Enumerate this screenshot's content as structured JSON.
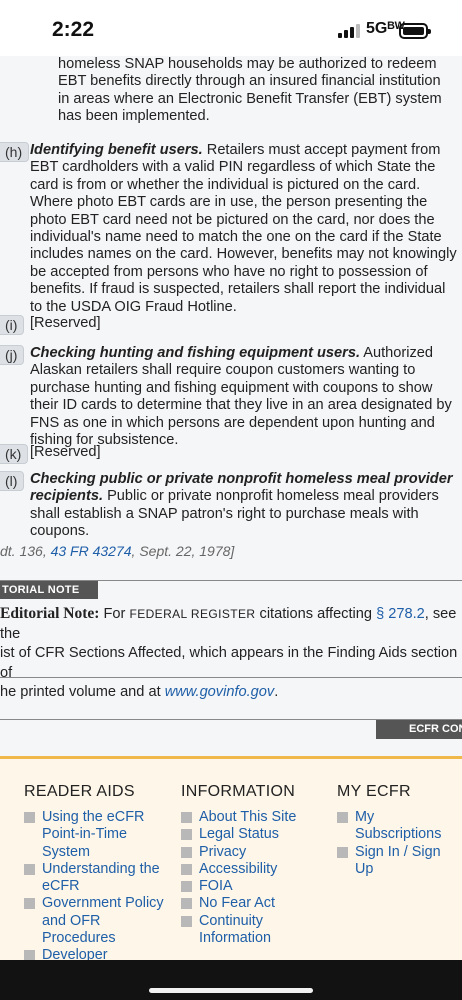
{
  "status_bar": {
    "time": "2:22",
    "network": "5Gᴮᵂ"
  },
  "regulation": {
    "g_continuation": "homeless SNAP households may be authorized to redeem EBT benefits directly through an insured financial institution in areas where an Electronic Benefit Transfer (EBT) system has been implemented.",
    "h": {
      "tag": "(h)",
      "heading": "Identifying benefit users.",
      "text": "Retailers must accept payment from EBT cardholders with a valid PIN regardless of which State the card is from or whether the individual is pictured on the card. Where photo EBT cards are in use, the person presenting the photo EBT card need not be pictured on the card, nor does the individual's name need to match the one on the card if the State includes names on the card. However, benefits may not knowingly be accepted from persons who have no right to possession of benefits. If fraud is suspected, retailers shall report the individual to the USDA OIG Fraud Hotline."
    },
    "i": {
      "tag": "(i)",
      "text": "[Reserved]"
    },
    "j": {
      "tag": "(j)",
      "heading": "Checking hunting and fishing equipment users.",
      "text": "Authorized Alaskan retailers shall require coupon customers wanting to purchase hunting and fishing equipment with coupons to show their ID cards to determine that they live in an area designated by FNS as one in which persons are dependent upon hunting and fishing for subsistence."
    },
    "k": {
      "tag": "(k)",
      "text": "[Reserved]"
    },
    "l": {
      "tag": "(l)",
      "heading": "Checking public or private nonprofit homeless meal provider recipients.",
      "text": "Public or private nonprofit homeless meal providers shall establish a SNAP patron's right to purchase meals with coupons."
    },
    "amendment": {
      "prefix": "dt. 136,",
      "link": "43 FR 43274",
      "suffix": ", Sept. 22, 1978]"
    }
  },
  "editorial": {
    "label": "TORIAL NOTE",
    "title": "Editorial Note:",
    "text1": "For",
    "fr": "FEDERAL REGISTER",
    "text2": "citations affecting",
    "section_link": "§ 278.2",
    "text3": ", see the",
    "line2": "ist of CFR Sections Affected, which appears in the Finding Aids section of",
    "line3_pre": "he printed volume and at",
    "govinfo": "www.govinfo.gov",
    "line3_post": "."
  },
  "ecfr_tab": "ECFR CON",
  "footer": {
    "reader_aids": {
      "heading": "READER AIDS",
      "items": [
        "Using the eCFR Point-in-Time System",
        "Understanding the eCFR",
        "Government Policy and OFR Procedures",
        "Developer"
      ]
    },
    "information": {
      "heading": "INFORMATION",
      "items": [
        "About This Site",
        "Legal Status",
        "Privacy",
        "Accessibility",
        "FOIA",
        "No Fear Act",
        "Continuity Information"
      ]
    },
    "my_ecfr": {
      "heading": "MY ECFR",
      "items": [
        "My Subscriptions",
        "Sign In / Sign Up"
      ]
    }
  }
}
